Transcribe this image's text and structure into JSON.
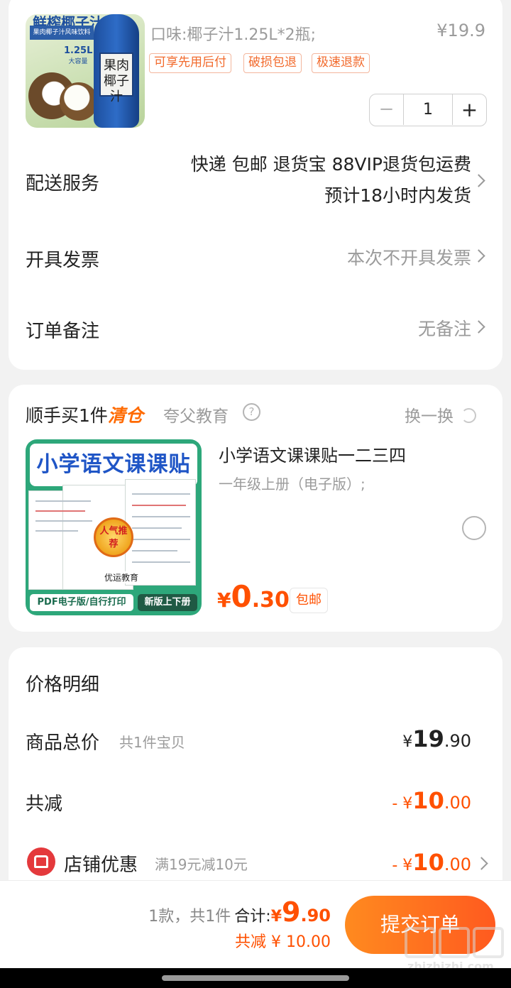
{
  "product": {
    "image_text": {
      "top": "鲜榨椰子汁",
      "strip": "果肉椰子汁风味饮料",
      "bottle_label": "果肉椰子汁",
      "size": "1.25L",
      "size_sub": "大容量"
    },
    "variant": "口味:椰子汁1.25L*2瓶;",
    "price": "¥19.9",
    "tags": [
      "可享先用后付",
      "破损包退",
      "极速退款"
    ],
    "quantity": "1",
    "minus": "−",
    "plus": "+"
  },
  "delivery": {
    "label": "配送服务",
    "line1": "快递 包邮 退货宝 88VIP退货包运费",
    "line2": "预计18小时内发货"
  },
  "invoice": {
    "label": "开具发票",
    "value": "本次不开具发票"
  },
  "note": {
    "label": "订单备注",
    "value": "无备注"
  },
  "addon": {
    "title": "顺手买1件",
    "highlight": "清仓",
    "shop": "夸父教育",
    "swap": "换一换",
    "item": {
      "image_title": "小学语文课课贴",
      "image_badge": "人气推荐",
      "image_brand": "优运教育",
      "image_footer_left": "PDF电子版/自行打印",
      "image_footer_right": "新版上下册",
      "name": "小学语文课课贴一二三四",
      "variant": "一年级上册（电子版）;",
      "price_symbol": "¥",
      "price_int": "0",
      "price_dec": ".30",
      "shipping": "包邮"
    }
  },
  "price_detail": {
    "title": "价格明细",
    "total_label": "商品总价",
    "total_count": "共1件宝贝",
    "total_symbol": "¥",
    "total_int": "19",
    "total_dec": ".90",
    "discount_label": "共减",
    "discount_prefix": "- ¥",
    "discount_int": "10",
    "discount_dec": ".00",
    "shop_label": "店铺优惠",
    "shop_rule": "满19元减10元",
    "shop_prefix": "- ¥",
    "shop_int": "10",
    "shop_dec": ".00"
  },
  "footer": {
    "count": "1款，共1件",
    "sum_label": "合计:",
    "sum_symbol": "¥",
    "sum_int": "9",
    "sum_dec": ".90",
    "saved": "共减 ¥ 10.00",
    "submit": "提交订单"
  },
  "watermark": "zhizhizhi.com",
  "colors": {
    "accent": "#ff5000",
    "tag_border": "#f3b69d",
    "brand_red": "#e4393c"
  }
}
